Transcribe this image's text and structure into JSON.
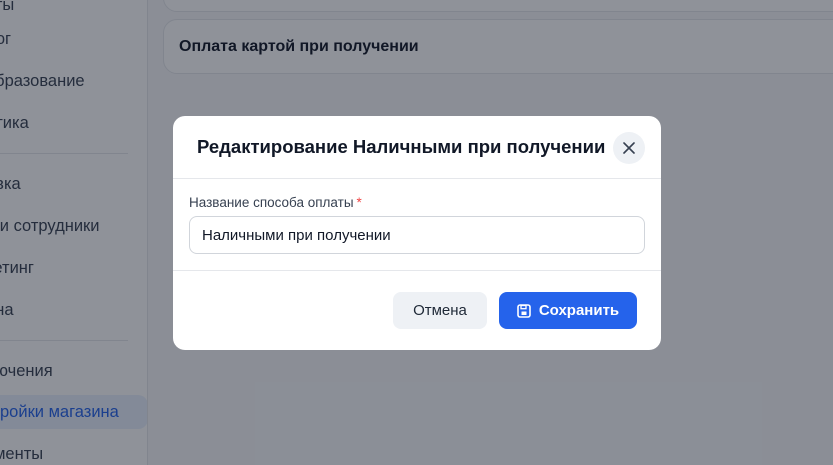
{
  "sidebar": {
    "items": [
      {
        "label": "аты"
      },
      {
        "label": "лог"
      },
      {
        "label": "образование"
      },
      {
        "label": "итика"
      },
      {
        "label": "авка"
      },
      {
        "label": "и и сотрудники"
      },
      {
        "label": "кетинг"
      },
      {
        "label": "ина"
      },
      {
        "label": "лючения"
      },
      {
        "label": "ройки магазина",
        "active": true
      },
      {
        "label": "ументы"
      }
    ]
  },
  "main": {
    "payment_method_card": {
      "title": "Оплата картой при получении"
    }
  },
  "modal": {
    "title": "Редактирование Наличными при получении",
    "field_label": "Название способа оплаты",
    "required_mark": "*",
    "field_value": "Наличными при получении",
    "cancel_label": "Отмена",
    "save_label": "Сохранить"
  },
  "colors": {
    "accent": "#2563eb",
    "required": "#ef4444",
    "overlay": "rgba(17,24,39,0.47)"
  },
  "icons": {
    "close": "close-icon",
    "save": "save-icon"
  }
}
